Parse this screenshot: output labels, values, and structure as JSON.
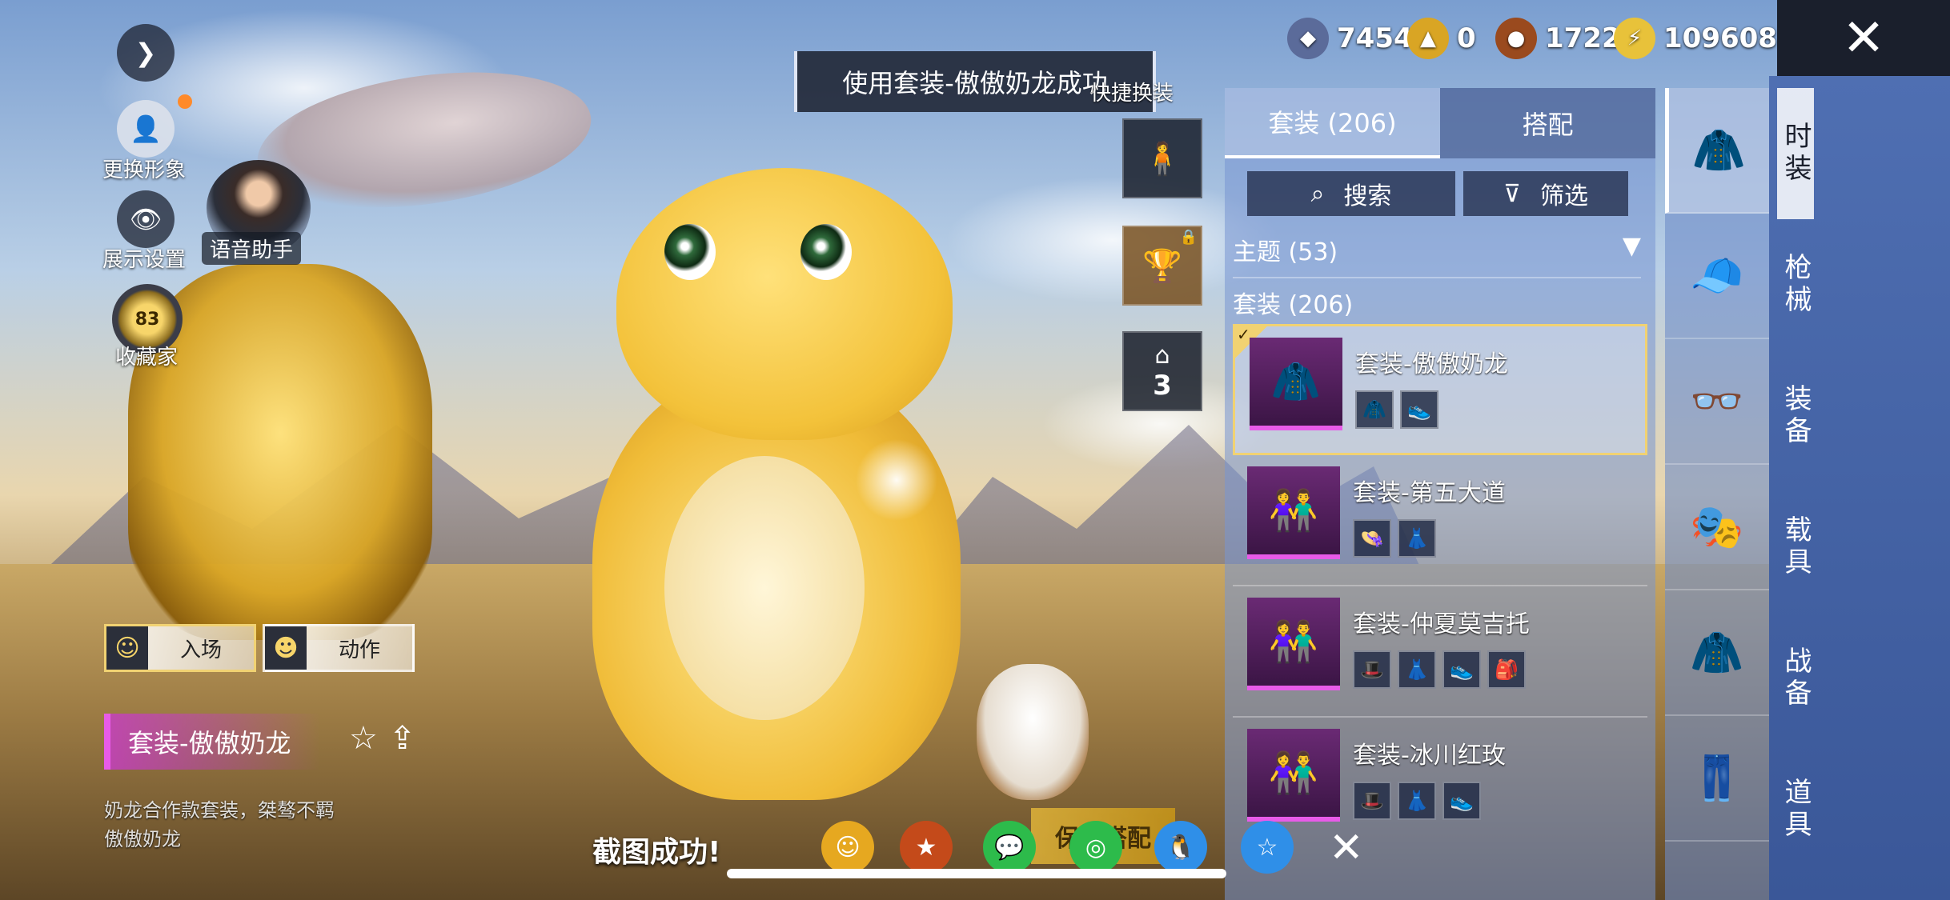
{
  "toast": {
    "message": "使用套装-傲傲奶龙成功"
  },
  "quick_switch": "快捷换装",
  "currency": [
    {
      "icon": "silver-coin-icon",
      "value": "7454",
      "color": "#5b6b9a"
    },
    {
      "icon": "gold-token-icon",
      "value": "0",
      "color": "#d9a524"
    },
    {
      "icon": "bronze-coin-icon",
      "value": "1722",
      "color": "#9a4a1e"
    },
    {
      "icon": "lightning-coupon-icon",
      "value": "109608",
      "color": "#e8c23a"
    }
  ],
  "left_menu": {
    "change_avatar": "更换形象",
    "display_settings": "展示设置",
    "voice_assistant": "语音助手",
    "collector": "收藏家",
    "collector_level": "83"
  },
  "actions": {
    "entrance": "入场",
    "motion": "动作"
  },
  "current_outfit": {
    "name": "套装-傲傲奶龙",
    "desc_line1": "奶龙合作款套装，桀骜不羁",
    "desc_line2": "傲傲奶龙"
  },
  "mini_slots": {
    "wardrobe_count": "3"
  },
  "panel": {
    "tab_outfit": "套装 (206)",
    "tab_combo": "搭配",
    "search": "搜索",
    "filter": "筛选",
    "theme": "主题 (53)",
    "count": "套装 (206)",
    "items": [
      {
        "name": "套装-傲傲奶龙",
        "sub": [
          "🧥",
          "👟"
        ]
      },
      {
        "name": "套装-第五大道",
        "sub": [
          "👒",
          "👗"
        ]
      },
      {
        "name": "套装-仲夏莫吉托",
        "sub": [
          "🎩",
          "👗",
          "👟",
          "🎒"
        ]
      },
      {
        "name": "套装-冰川红玫",
        "sub": [
          "🎩",
          "👗",
          "👟"
        ]
      }
    ]
  },
  "nav": [
    "时装",
    "枪械",
    "装备",
    "载具",
    "战备",
    "道具"
  ],
  "bottom": {
    "snap_success": "截图成功!",
    "combo_button": "保存搭配"
  }
}
